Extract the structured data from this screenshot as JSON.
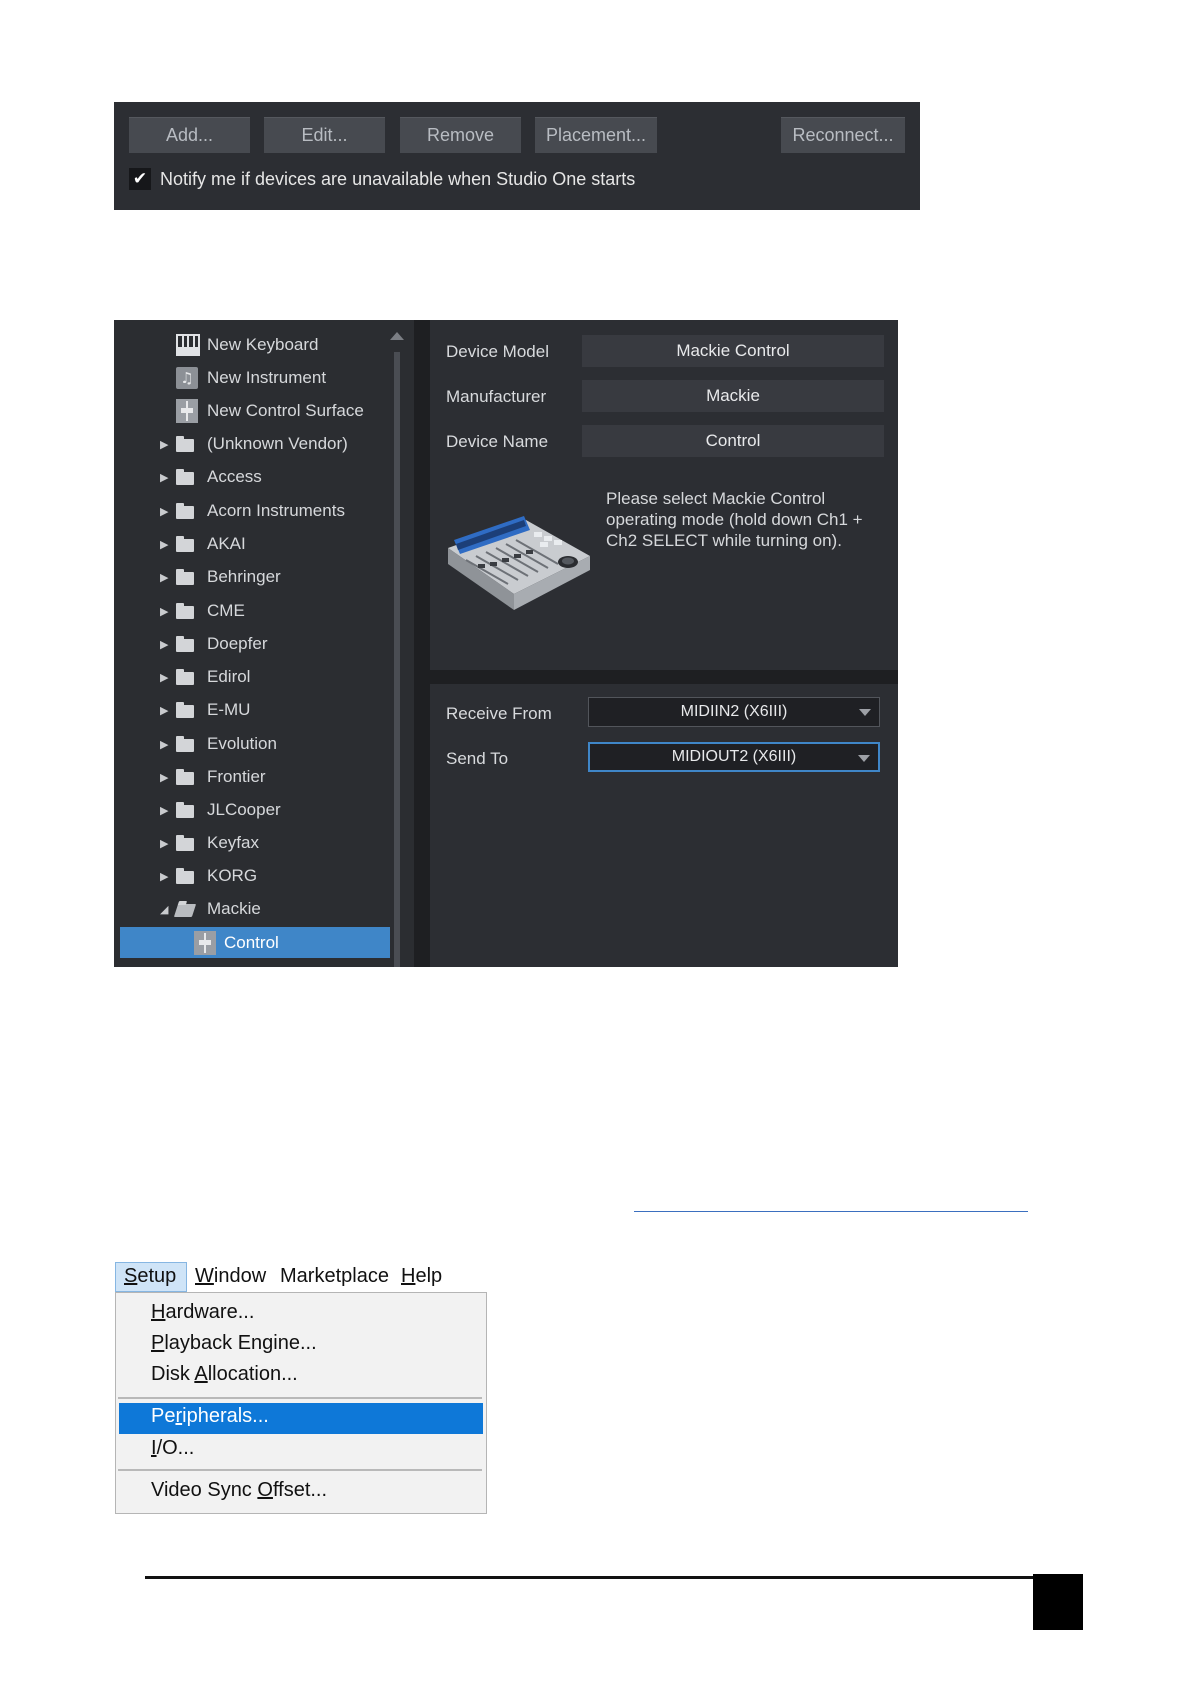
{
  "toolbar": {
    "buttons": [
      "Add...",
      "Edit...",
      "Remove",
      "Placement...",
      "Reconnect..."
    ],
    "notify_label": "Notify me if devices are unavailable when Studio One starts",
    "notify_checked": true
  },
  "tree": {
    "items": [
      {
        "label": "New Keyboard",
        "icon": "keyboard-icon"
      },
      {
        "label": "New Instrument",
        "icon": "instrument-icon"
      },
      {
        "label": "New Control Surface",
        "icon": "control-surface-icon"
      },
      {
        "label": "(Unknown Vendor)",
        "icon": "folder-icon"
      },
      {
        "label": "Access",
        "icon": "folder-icon"
      },
      {
        "label": "Acorn Instruments",
        "icon": "folder-icon"
      },
      {
        "label": "AKAI",
        "icon": "folder-icon"
      },
      {
        "label": "Behringer",
        "icon": "folder-icon"
      },
      {
        "label": "CME",
        "icon": "folder-icon"
      },
      {
        "label": "Doepfer",
        "icon": "folder-icon"
      },
      {
        "label": "Edirol",
        "icon": "folder-icon"
      },
      {
        "label": "E-MU",
        "icon": "folder-icon"
      },
      {
        "label": "Evolution",
        "icon": "folder-icon"
      },
      {
        "label": "Frontier",
        "icon": "folder-icon"
      },
      {
        "label": "JLCooper",
        "icon": "folder-icon"
      },
      {
        "label": "Keyfax",
        "icon": "folder-icon"
      },
      {
        "label": "KORG",
        "icon": "folder-icon"
      },
      {
        "label": "Mackie",
        "icon": "folder-open-icon"
      },
      {
        "label": "Control",
        "icon": "control-surface-icon"
      }
    ],
    "selected": "Control"
  },
  "device": {
    "model_label": "Device Model",
    "model_value": "Mackie Control",
    "manufacturer_label": "Manufacturer",
    "manufacturer_value": "Mackie",
    "name_label": "Device Name",
    "name_value": "Control",
    "note": "Please select Mackie Control operating mode (hold down Ch1 + Ch2 SELECT while turning on).",
    "receive_label": "Receive From",
    "receive_value": "MIDIIN2 (X6III)",
    "send_label": "Send To",
    "send_value": "MIDIOUT2 (X6III)"
  },
  "menu": {
    "top": [
      {
        "label": "Setup",
        "mnemonic": 0
      },
      {
        "label": "Window",
        "mnemonic": 0
      },
      {
        "label": "Marketplace",
        "mnemonic": -1
      },
      {
        "label": "Help",
        "mnemonic": 0
      }
    ],
    "items": [
      {
        "label": "Hardware...",
        "mnemonic": 0
      },
      {
        "label": "Playback Engine...",
        "mnemonic": 0
      },
      {
        "label": "Disk Allocation...",
        "mnemonic": 5
      },
      {
        "label": "Peripherals...",
        "mnemonic": 2
      },
      {
        "label": "I/O...",
        "mnemonic": 0
      },
      {
        "label": "Video Sync Offset...",
        "mnemonic": 11
      }
    ],
    "highlighted": "Peripherals..."
  },
  "colors": {
    "accent": "#3f86c8",
    "menu_highlight": "#0e78d8",
    "panel_bg": "#2c2e33"
  }
}
